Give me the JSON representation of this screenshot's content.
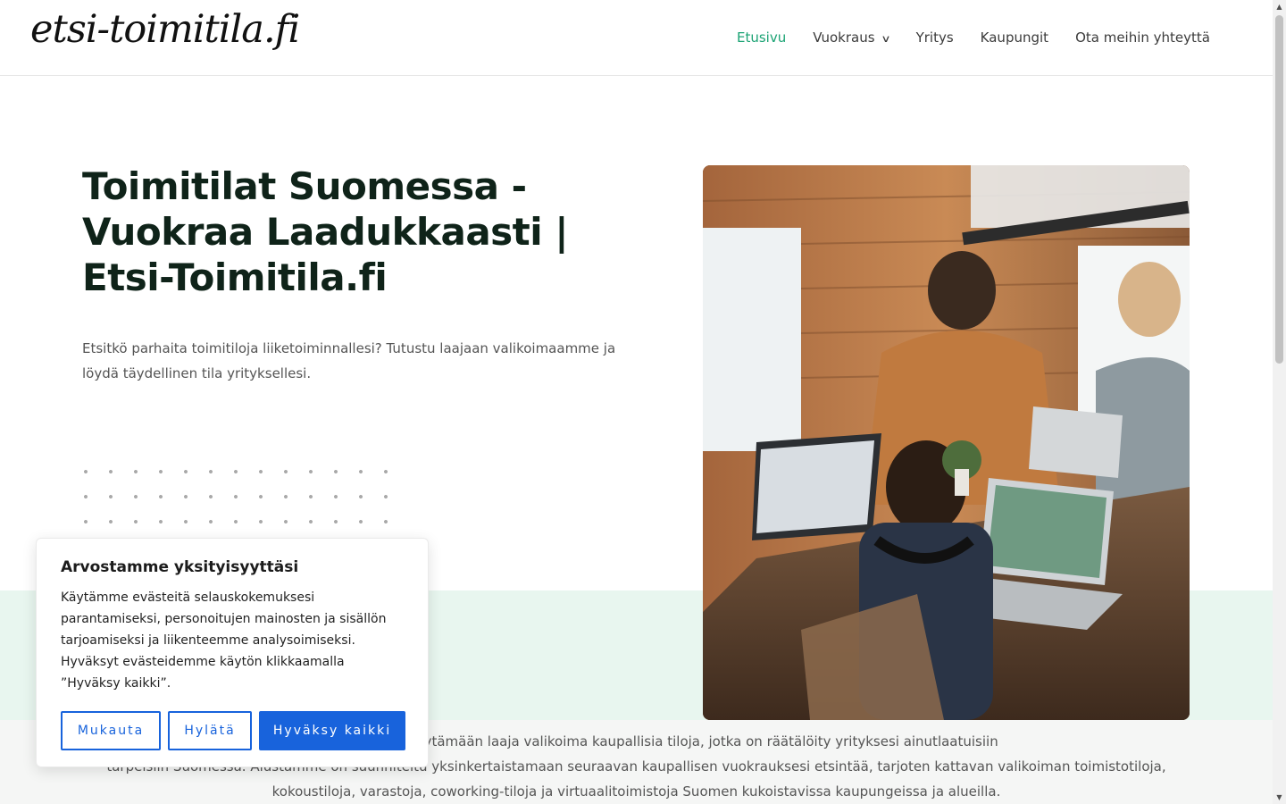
{
  "header": {
    "logo": "etsi-toimitila.fi",
    "nav": [
      {
        "label": "Etusivu",
        "active": true
      },
      {
        "label": "Vuokraus",
        "has_dropdown": true
      },
      {
        "label": "Yritys"
      },
      {
        "label": "Kaupungit"
      },
      {
        "label": "Ota meihin yhteyttä"
      }
    ]
  },
  "hero": {
    "title": "Toimitilat Suomessa - Vuokraa Laadukkaasti | Etsi-Toimitila.fi",
    "text": "Etsitkö parhaita toimitiloja liiketoiminnallesi? Tutustu laajaan valikoimaamme ja löydä täydellinen tila yrityksellesi.",
    "image_icon": "office-coworking-photo"
  },
  "intro": {
    "line1": "een määränpäähäsi löytämään laaja valikoima kaupallisia tiloja, jotka on räätälöity yrityksesi ainutlaatuisiin",
    "line2": "tarpeisiin Suomessa. Alustamme on suunniteltu yksinkertaistamaan seuraavan kaupallisen vuokrauksesi etsintää, tarjoten kattavan valikoiman toimistotiloja,",
    "line3": "kokoustiloja, varastoja, coworking-tiloja ja virtuaalitoimistoja Suomen kukoistavissa kaupungeissa ja alueilla."
  },
  "cookie": {
    "title": "Arvostamme yksityisyyttäsi",
    "text": "Käytämme evästeitä selauskokemuksesi parantamiseksi, personoitujen mainosten ja sisällön tarjoamiseksi ja liikenteemme analysoimiseksi. Hyväksyt evästeidemme käytön klikkaamalla ”Hyväksy kaikki”.",
    "buttons": {
      "customize": "Mukauta",
      "reject": "Hylätä",
      "accept_all": "Hyväksy kaikki"
    }
  },
  "colors": {
    "accent_green": "#1ba374",
    "title_dark": "#0f2319",
    "cookie_blue": "#1863dc",
    "band_green": "#e8f6ef"
  }
}
